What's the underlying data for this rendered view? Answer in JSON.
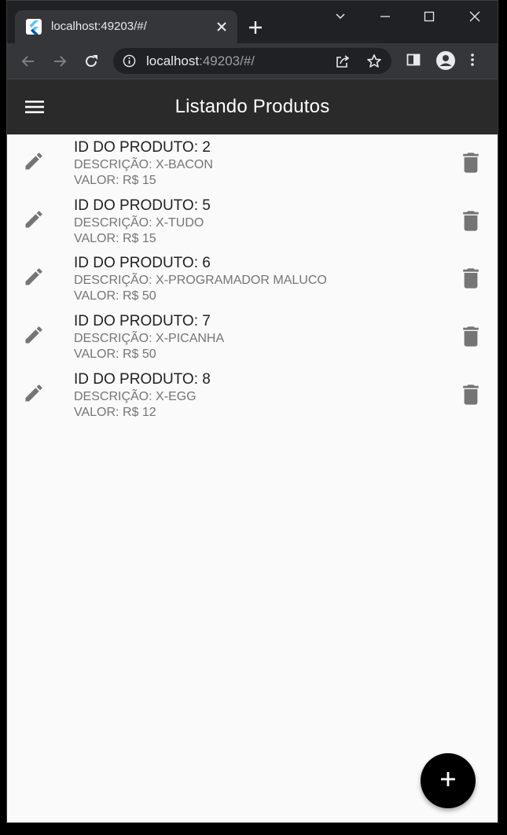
{
  "browser": {
    "tab_title": "localhost:49203/#/",
    "url_host": "localhost",
    "url_path": ":49203/#/"
  },
  "app": {
    "title": "Listando Produtos"
  },
  "products": [
    {
      "id_label": "ID DO PRODUTO: 2",
      "desc_label": "DESCRIÇÃO: X-BACON",
      "value_label": "VALOR: R$ 15"
    },
    {
      "id_label": "ID DO PRODUTO: 5",
      "desc_label": "DESCRIÇÃO: X-TUDO",
      "value_label": "VALOR: R$ 15"
    },
    {
      "id_label": "ID DO PRODUTO: 6",
      "desc_label": "DESCRIÇÃO: X-PROGRAMADOR MALUCO",
      "value_label": "VALOR: R$ 50"
    },
    {
      "id_label": "ID DO PRODUTO: 7",
      "desc_label": "DESCRIÇÃO: X-PICANHA",
      "value_label": "VALOR: R$ 50"
    },
    {
      "id_label": "ID DO PRODUTO: 8",
      "desc_label": "DESCRIÇÃO: X-EGG",
      "value_label": "VALOR: R$ 12"
    }
  ],
  "icons": {
    "menu": "hamburger-menu-icon",
    "edit": "pencil-icon",
    "delete": "trash-icon",
    "add": "plus-icon"
  },
  "colors": {
    "appbar": "#2b2a2a",
    "background": "#fafafa",
    "fab": "#000000",
    "icon_grey": "#757575"
  }
}
